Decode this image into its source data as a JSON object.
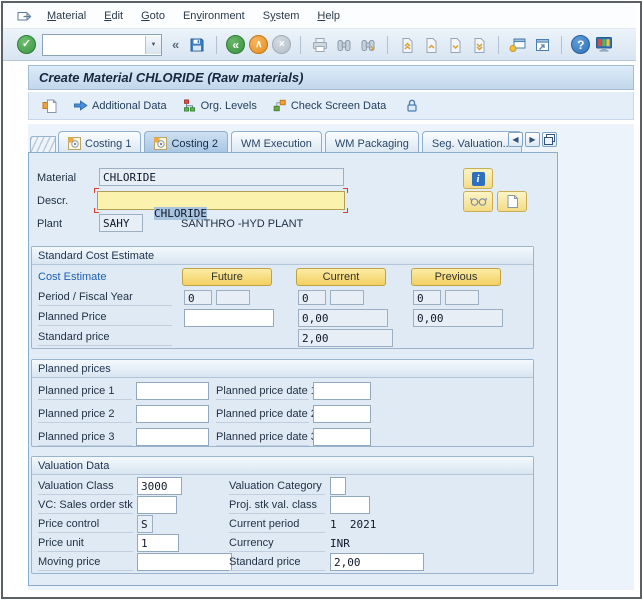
{
  "glyphs": {
    "check": "✓",
    "back": "«",
    "exit": "∧",
    "cancel": "×",
    "collapse": "«",
    "dropdown": "▼",
    "help": "?",
    "info": "i",
    "tab_prev": "◀",
    "tab_next": "▶"
  },
  "menu_bar": {
    "items": [
      {
        "pre": "",
        "key": "M",
        "post": "aterial"
      },
      {
        "pre": "",
        "key": "E",
        "post": "dit"
      },
      {
        "pre": "",
        "key": "G",
        "post": "oto"
      },
      {
        "pre": "En",
        "key": "v",
        "post": "ironment"
      },
      {
        "pre": "S",
        "key": "y",
        "post": "stem"
      },
      {
        "pre": "",
        "key": "H",
        "post": "elp"
      }
    ]
  },
  "toolbar": {
    "command_value": ""
  },
  "title_bar": {
    "title": "Create Material CHLORIDE (Raw materials)"
  },
  "app_toolbar": {
    "buttons": [
      "Additional Data",
      "Org. Levels",
      "Check Screen Data"
    ]
  },
  "tab_strip": {
    "tabs": [
      "Costing 1",
      "Costing 2",
      "WM Execution",
      "WM Packaging",
      "Seg. Valuation..."
    ],
    "active": "Costing 2"
  },
  "header_fields": {
    "material": {
      "label": "Material",
      "value": "CHLORIDE"
    },
    "descr": {
      "label": "Descr.",
      "value": "CHLORIDE"
    },
    "plant": {
      "label": "Plant",
      "value": "SAHY",
      "description": "SANTHRO -HYD PLANT"
    }
  },
  "standard_cost_estimate": {
    "title": "Standard Cost Estimate",
    "cost_estimate_label": "Cost Estimate",
    "buttons": [
      "Future",
      "Current",
      "Previous"
    ],
    "period_label": "Period / Fiscal Year",
    "periods": {
      "future": [
        "0",
        ""
      ],
      "current": [
        "0",
        ""
      ],
      "previous": [
        "0",
        ""
      ]
    },
    "planned_price_label": "Planned Price",
    "planned": {
      "future": "",
      "current": "0,00",
      "previous": "0,00"
    },
    "standard_price_label": "Standard price",
    "standard_current": "2,00"
  },
  "planned_prices": {
    "title": "Planned prices",
    "rows": [
      {
        "label": "Planned price 1",
        "value": "",
        "date_label": "Planned price date 1",
        "date_value": ""
      },
      {
        "label": "Planned price 2",
        "value": "",
        "date_label": "Planned price date 2",
        "date_value": ""
      },
      {
        "label": "Planned price 3",
        "value": "",
        "date_label": "Planned price date 3",
        "date_value": ""
      }
    ]
  },
  "valuation_data": {
    "title": "Valuation Data",
    "left": [
      {
        "label": "Valuation Class",
        "value": "3000"
      },
      {
        "label": "VC: Sales order stk",
        "value": ""
      },
      {
        "label": "Price control",
        "value": "S"
      },
      {
        "label": "Price unit",
        "value": "1"
      },
      {
        "label": "Moving price",
        "value": ""
      }
    ],
    "right": [
      {
        "label": "Valuation Category",
        "value": ""
      },
      {
        "label": "Proj. stk val. class",
        "value": ""
      },
      {
        "label": "Current period",
        "value": "1  2021"
      },
      {
        "label": "Currency",
        "value": "INR"
      },
      {
        "label": "Standard price",
        "value": "2,00"
      }
    ]
  }
}
